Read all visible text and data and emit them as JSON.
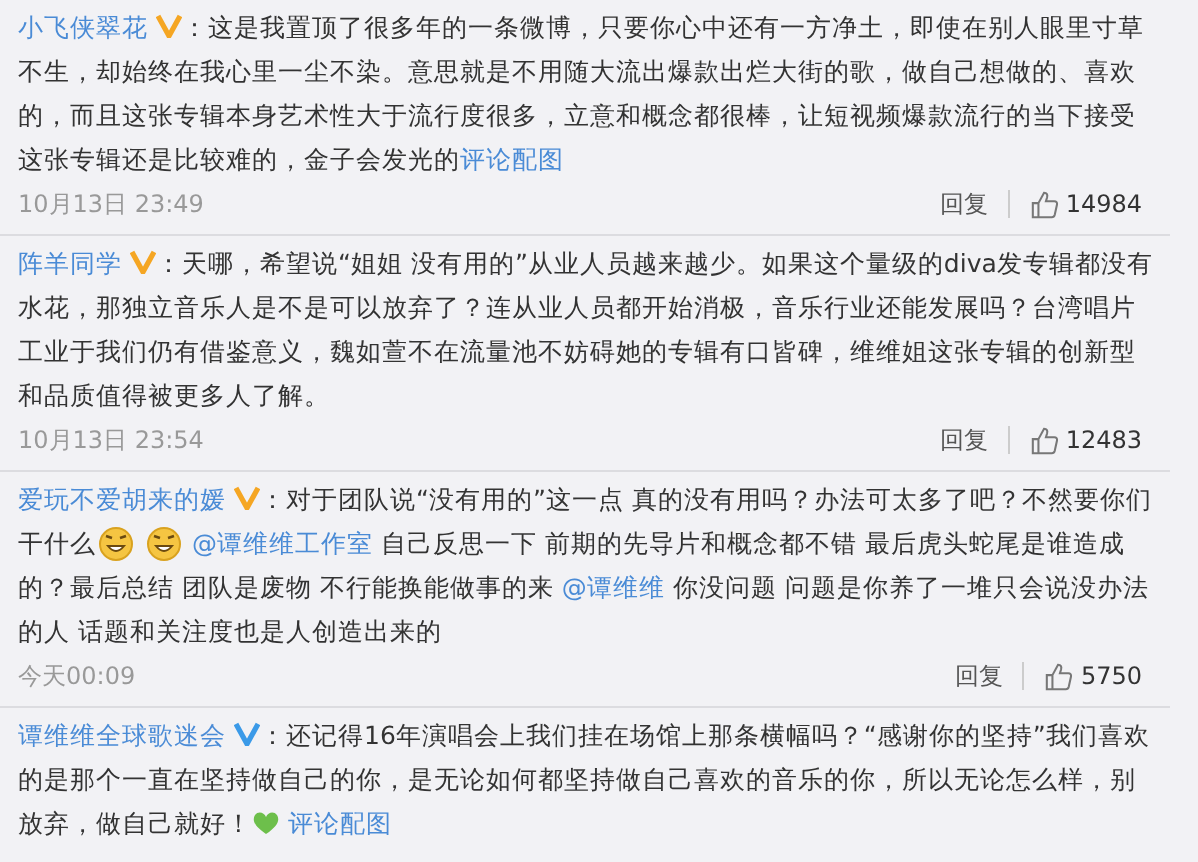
{
  "comments": [
    {
      "user": "小飞侠翠花",
      "badge": {
        "color": "#f5a623"
      },
      "body": [
        {
          "kind": "text",
          "text": "：这是我置顶了很多年的一条微博，只要你心中还有一方净土，即使在别人眼里寸草不生，却始终在我心里一尘不染。意思就是不用随大流出爆款出烂大街的歌，做自己想做的、喜欢的，而且这张专辑本身艺术性大于流行度很多，立意和概念都很棒，让短视频爆款流行的当下接受这张专辑还是比较难的，金子会发光的"
        },
        {
          "kind": "link",
          "text": "评论配图"
        }
      ],
      "time": "10月13日 23:49",
      "reply": "回复",
      "likes": "14984"
    },
    {
      "user": "阵羊同学",
      "badge": {
        "color": "#f5a623"
      },
      "body": [
        {
          "kind": "text",
          "text": "：天哪，希望说“姐姐 没有用的”从业人员越来越少。如果这个量级的diva发专辑都没有水花，那独立音乐人是不是可以放弃了？连从业人员都开始消极，音乐行业还能发展吗？台湾唱片工业于我们仍有借鉴意义，魏如萱不在流量池不妨碍她的专辑有口皆碑，维维姐这张专辑的创新型和品质值得被更多人了解。"
        }
      ],
      "time": "10月13日 23:54",
      "reply": "回复",
      "likes": "12483"
    },
    {
      "user": "爱玩不爱胡来的媛",
      "badge": {
        "color": "#f5a623"
      },
      "body": [
        {
          "kind": "text",
          "text": "：对于团队说“没有用的”这一点 真的没有用吗？办法可太多了吧？不然要你们干什么"
        },
        {
          "kind": "emoji"
        },
        {
          "kind": "emoji"
        },
        {
          "kind": "mention",
          "text": "@谭维维工作室"
        },
        {
          "kind": "text",
          "text": " 自己反思一下 前期的先导片和概念都不错 最后虎头蛇尾是谁造成的？最后总结 团队是废物 不行能换能做事的来 "
        },
        {
          "kind": "mention",
          "text": "@谭维维"
        },
        {
          "kind": "text",
          "text": " 你没问题 问题是你养了一堆只会说没办法的人 话题和关注度也是人创造出来的"
        }
      ],
      "time": "今天00:09",
      "reply": "回复",
      "likes": "5750"
    },
    {
      "user": "谭维维全球歌迷会",
      "badge": {
        "color": "#3b9ae8"
      },
      "body": [
        {
          "kind": "text",
          "text": "：还记得16年演唱会上我们挂在场馆上那条横幅吗？“感谢你的坚持”我们喜欢的是那个一直在坚持做自己的你，是无论如何都坚持做自己喜欢的音乐的你，所以无论怎么样，别放弃，做自己就好！"
        },
        {
          "kind": "heart"
        },
        {
          "kind": "link",
          "text": "评论配图"
        }
      ]
    }
  ]
}
